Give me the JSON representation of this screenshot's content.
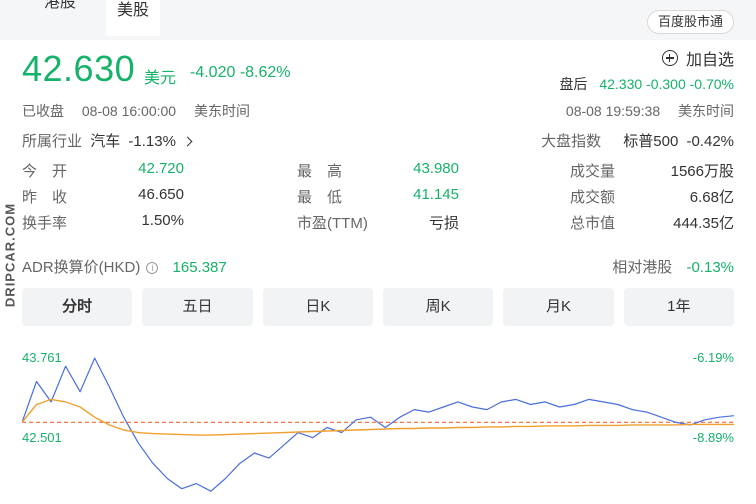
{
  "tabs": [
    "港股",
    "美股"
  ],
  "baidu_link": "百度股市通",
  "quote": {
    "price": "42.630",
    "currency": "美元",
    "change": "-4.020",
    "change_pct": "-8.62%"
  },
  "add_watchlist": "加自选",
  "after_hours": {
    "label": "盘后",
    "price": "42.330",
    "change": "-0.300",
    "change_pct": "-0.70%",
    "time": "08-08 19:59:38",
    "tz": "美东时间"
  },
  "status": {
    "state": "已收盘",
    "time": "08-08 16:00:00",
    "tz": "美东时间"
  },
  "industry": {
    "label": "所属行业",
    "name": "汽车",
    "change": "-1.13%"
  },
  "market_index": {
    "label": "大盘指数",
    "name": "标普500",
    "change": "-0.42%"
  },
  "stats": [
    [
      {
        "label": "今　开",
        "value": "42.720",
        "color": "green"
      },
      {
        "label": "最　高",
        "value": "43.980",
        "color": "green"
      },
      {
        "label": "成交量",
        "value": "1566万股",
        "color": "dark"
      }
    ],
    [
      {
        "label": "昨　收",
        "value": "46.650",
        "color": "dark"
      },
      {
        "label": "最　低",
        "value": "41.145",
        "color": "green"
      },
      {
        "label": "成交额",
        "value": "6.68亿",
        "color": "dark"
      }
    ],
    [
      {
        "label": "换手率",
        "value": "1.50%",
        "color": "dark"
      },
      {
        "label": "市盈(TTM)",
        "value": "亏损",
        "color": "dark"
      },
      {
        "label": "总市值",
        "value": "444.35亿",
        "color": "dark"
      }
    ]
  ],
  "adr": {
    "label": "ADR换算价(HKD)",
    "value": "165.387"
  },
  "relative_hk": {
    "label": "相对港股",
    "value": "-0.13%"
  },
  "watermark": "DRIPCAR.COM",
  "periods": [
    "分时",
    "五日",
    "日K",
    "周K",
    "月K",
    "1年"
  ],
  "chart_axis": {
    "y_top": "43.761",
    "y_mid": "42.501",
    "pct_top": "-6.19%",
    "pct_mid": "-8.89%"
  },
  "chart_data": {
    "type": "line",
    "series": [
      {
        "values": [
          42.5,
          43.3,
          42.9,
          43.6,
          43.1,
          43.76,
          43.2,
          42.6,
          42.1,
          41.7,
          41.4,
          41.2,
          41.3,
          41.15,
          41.4,
          41.7,
          41.9,
          41.8,
          42.05,
          42.3,
          42.2,
          42.4,
          42.3,
          42.55,
          42.6,
          42.4,
          42.6,
          42.75,
          42.7,
          42.8,
          42.9,
          42.8,
          42.75,
          42.9,
          42.95,
          42.85,
          42.9,
          42.8,
          42.85,
          42.95,
          42.9,
          42.85,
          42.75,
          42.7,
          42.6,
          42.5,
          42.45,
          42.55,
          42.6,
          42.63
        ]
      },
      {
        "values": [
          42.5,
          42.85,
          42.95,
          42.9,
          42.8,
          42.6,
          42.45,
          42.35,
          42.3,
          42.28,
          42.27,
          42.26,
          42.25,
          42.25,
          42.26,
          42.27,
          42.28,
          42.29,
          42.3,
          42.31,
          42.32,
          42.33,
          42.34,
          42.35,
          42.36,
          42.37,
          42.38,
          42.38,
          42.39,
          42.39,
          42.4,
          42.4,
          42.41,
          42.41,
          42.42,
          42.42,
          42.43,
          42.43,
          42.43,
          42.44,
          42.44,
          42.44,
          42.45,
          42.45,
          42.45,
          42.45,
          42.46,
          42.46,
          42.46,
          42.46
        ]
      }
    ],
    "reference_line": 42.501,
    "ylim": [
      40.9,
      43.761
    ]
  }
}
